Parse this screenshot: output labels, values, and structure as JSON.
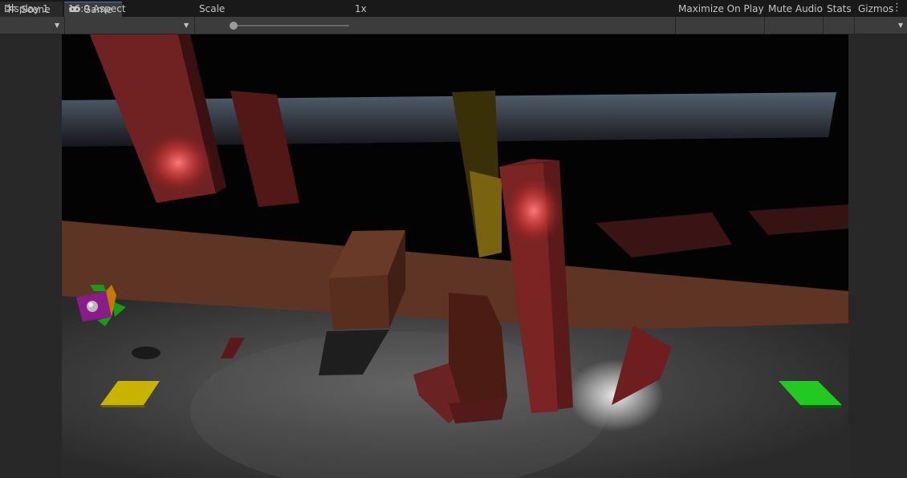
{
  "tabs": [
    {
      "label": "Scene",
      "icon": "grid-icon",
      "active": false
    },
    {
      "label": "Game",
      "icon": "gamepad-icon",
      "active": true
    }
  ],
  "toolbar": {
    "display": "Display 1",
    "aspect": "16:9 Aspect",
    "scale_label": "Scale",
    "scale_value": "1x",
    "scale_level": 0.0,
    "maximize": "Maximize On Play",
    "mute": "Mute Audio",
    "stats": "Stats",
    "gizmos": "Gizmos"
  },
  "colors": {
    "editor_bg": "#282828",
    "tab_active_accent": "#3a79bb",
    "goal_yellow": "#d4c000",
    "goal_green": "#1ed21e"
  }
}
